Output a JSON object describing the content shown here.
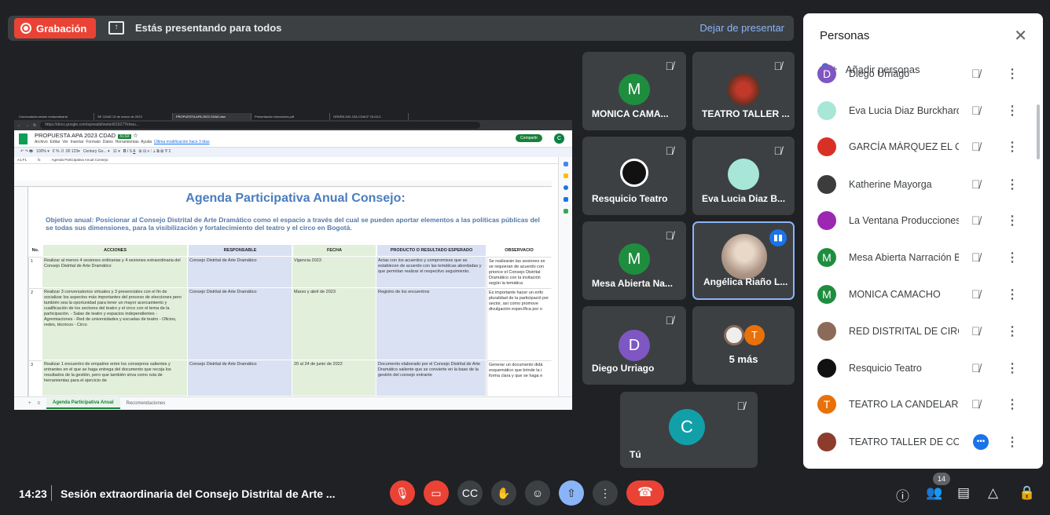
{
  "topbar": {
    "recording_label": "Grabación",
    "presenting_text": "Estás presentando para todos",
    "stop_presenting": "Dejar de presentar"
  },
  "shared_screen": {
    "browser_tabs": [
      "Convocatoria sesión extraordinaria",
      "SE CDAD 13 de marzo de 2023",
      "PROPUESTA APA 2023 CDAD.xlsx",
      "Presentación elecciones.pdf",
      "ORDEN DEL DÍA CDACF 15-03-2"
    ],
    "url": "https://docs.google.com/spreadsheets/d/1627Tkhwu...",
    "doc_title": "PROPUESTA APA 2023 CDAD",
    "doc_badge": "XLSX",
    "menu": [
      "Archivo",
      "Editar",
      "Ver",
      "Insertar",
      "Formato",
      "Datos",
      "Herramientas",
      "Ayuda"
    ],
    "last_edit": "Última modificación hace 3 días",
    "share_label": "Compartir",
    "user_initial": "C",
    "cell_ref": "A1:F1",
    "formula": "Agenda Participativa Anual Consejo:",
    "sheet_title": "Agenda Participativa Anual Consejo:",
    "objective": "Objetivo anual: Posicionar al Consejo Distrital de Arte Dramático como el espacio a través del cual se pueden aportar elementos a las políticas públicas del se todas sus dimensiones, para la visibilización y fortalecimiento del teatro y el circo en Bogotá.",
    "headers": [
      "No.",
      "ACCIONES",
      "RESPONSABLE",
      "FECHA",
      "PRODUCTO O RESULTADO ESPERADO",
      "OBSERVACIO"
    ],
    "rows": [
      [
        "1",
        "Realizar al menos 4 sesiones ordinarias y 4 sesiones extraordinaria del Consejo Distrital de Arte Dramático",
        "Consejo Distrital de Arte Dramático",
        "Vigencia 2023",
        "Actas con los acuerdos y compromisos que se establecen de acuerdo con las temáticas abordadas y que permitan realizar el respectivo seguimiento.",
        "Se realizarán las sesiones ex se requieran de acuerdo con priorice el Consejo Distrital Dramático con la invitación según la temática"
      ],
      [
        "2",
        "Realizar 3 conversatorios virtuales y 3 presenciales con el fin de socializar los aspectos más importantes del proceso de elecciones pero también sea la oportunidad para tener un mayor acercamiento y cualificación de los sectores del teatro y el circo con el tema de la participación. - Salas de teatro y espacios independientes - Agremiaciones - Red de universidades y escuelas de teatro - Oficios, redes, técnicos - Circo",
        "Consejo Distrital de Arte Dramático",
        "Marzo y abril de 2023",
        "Registro de los encuentros",
        "Es importante hacer un enfo pluralidad de la participació por sector, así como promove divulgación específica por o"
      ],
      [
        "3",
        "Realizar 1 encuentro de empalme entre los consejeros salientes y entrantes en el que se haga entrega del documento que recoja los resultados de la gestión, pero que también sirva como ruta de herramientas para el ejercicio de",
        "Consejo Distrital de Arte Dramático",
        "20 al 24 de junio de 2022",
        "Documento elaborado por el Consejo Distrital de Arte Dramático saliente que se convierte en la base de la gestión del consejo entrante",
        "Generar un documento didá esquemático que brinde la i forma clara y que se haga e"
      ]
    ],
    "sheet_tabs": [
      "Agenda Participativa Anual",
      "Recomendaciones"
    ]
  },
  "tiles": [
    {
      "name": "MONICA CAMA...",
      "initial": "M",
      "color": "#1e8e3e"
    },
    {
      "name": "TEATRO TALLER ...",
      "initial": "",
      "color": "#8d3b2b"
    },
    {
      "name": "Resquicio Teatro",
      "initial": "",
      "color": "#111111"
    },
    {
      "name": "Eva Lucia Diaz B...",
      "initial": "",
      "color": "#a8e6d8"
    },
    {
      "name": "Mesa Abierta Na...",
      "initial": "M",
      "color": "#1e8e3e"
    },
    {
      "name": "Angélica Riaño L...",
      "initial": "",
      "color": "#c9b8a8"
    },
    {
      "name": "Diego Urriago",
      "initial": "D",
      "color": "#7e57c2"
    },
    {
      "name": "5 más",
      "initial": "T",
      "color": "#e8710a"
    },
    {
      "name": "Tú",
      "initial": "C",
      "color": "#12a0a8"
    }
  ],
  "people_panel": {
    "title": "Personas",
    "add_label": "Añadir personas",
    "people": [
      {
        "name": "Diego Urriago",
        "initial": "D",
        "color": "#7e57c2"
      },
      {
        "name": "Eva Lucia Diaz Burckhardt",
        "initial": "",
        "color": "#a8e6d8"
      },
      {
        "name": "GARCÍA MÁRQUEZ EL OR...",
        "initial": "",
        "color": "#d93025"
      },
      {
        "name": "Katherine Mayorga",
        "initial": "",
        "color": "#3c3c3c"
      },
      {
        "name": "La Ventana Producciones",
        "initial": "",
        "color": "#9c27b0"
      },
      {
        "name": "Mesa Abierta Narración B...",
        "initial": "M",
        "color": "#1e8e3e"
      },
      {
        "name": "MONICA CAMACHO",
        "initial": "M",
        "color": "#1e8e3e"
      },
      {
        "name": "RED DISTRITAL DE CIRCO...",
        "initial": "",
        "color": "#8c6a5a"
      },
      {
        "name": "Resquicio Teatro",
        "initial": "",
        "color": "#111111"
      },
      {
        "name": "TEATRO LA CANDELARIA",
        "initial": "T",
        "color": "#e8710a"
      },
      {
        "name": "TEATRO TALLER DE COL...",
        "initial": "",
        "color": "#8d3b2b"
      }
    ]
  },
  "bottom": {
    "time": "14:23",
    "meeting_title": "Sesión extraordinaria del Consejo Distrital de Arte ...",
    "participant_count": "14"
  }
}
